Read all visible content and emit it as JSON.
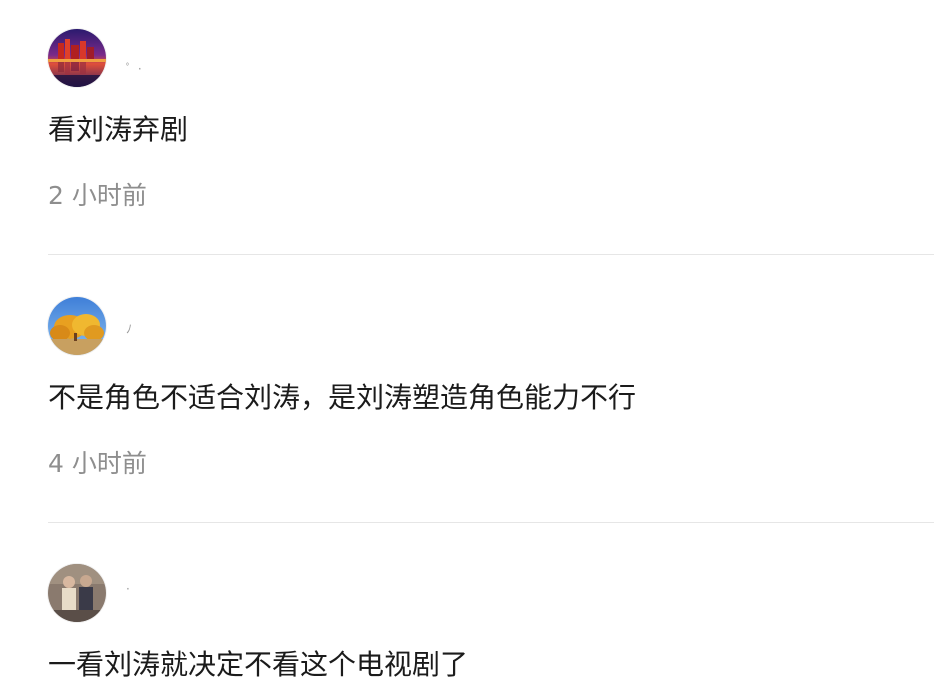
{
  "comments": [
    {
      "username": "ﾟ ·",
      "text": "看刘涛弃剧",
      "time": "2 小时前",
      "avatar_icon": "sunset-lake-avatar-icon"
    },
    {
      "username": "ﾉ",
      "text": "不是角色不适合刘涛，是刘涛塑造角色能力不行",
      "time": "4 小时前",
      "avatar_icon": "autumn-tree-avatar-icon"
    },
    {
      "username": "·",
      "text": "一看刘涛就决定不看这个电视剧了",
      "time": "",
      "avatar_icon": "couple-photo-avatar-icon"
    }
  ],
  "colors": {
    "text": "#1b1b1b",
    "timestamp": "#8e8e8e",
    "divider": "#e6e6e6",
    "background": "#ffffff"
  }
}
